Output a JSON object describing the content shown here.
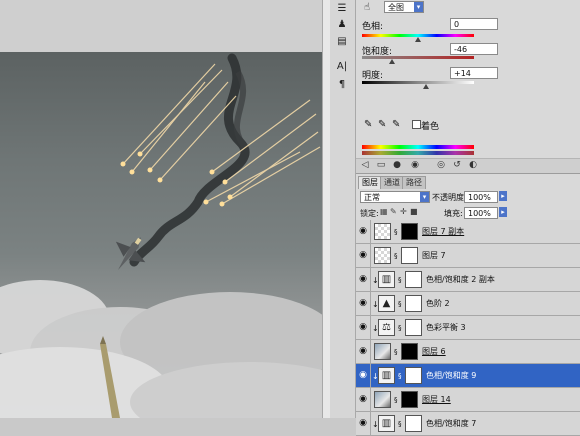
{
  "adjustments": {
    "preset_select": "全图",
    "hue": {
      "label": "色相:",
      "value": "0",
      "slider": 0.5
    },
    "saturation": {
      "label": "饱和度:",
      "value": "-46",
      "slider": 0.27
    },
    "lightness": {
      "label": "明度:",
      "value": "+14",
      "slider": 0.57
    },
    "colorize_label": "着色",
    "colorize_checked": false
  },
  "layers_panel": {
    "tabs": [
      "图层",
      "通道",
      "路径"
    ],
    "active_tab": 0,
    "blend_mode": "正常",
    "opacity_label": "不透明度:",
    "opacity_value": "100%",
    "lock_label": "锁定:",
    "fill_label": "填充:",
    "fill_value": "100%",
    "layers": [
      {
        "name": "图层 7 副本",
        "thumb": "checker",
        "mask": "black",
        "clipped": false,
        "underline": true,
        "selected": false
      },
      {
        "name": "图层 7",
        "thumb": "checker",
        "mask": "white",
        "clipped": false,
        "underline": false,
        "selected": false
      },
      {
        "name": "色相/饱和度 2 副本",
        "thumb": "adj-hue",
        "mask": "white",
        "clipped": true,
        "underline": false,
        "selected": false
      },
      {
        "name": "色阶 2",
        "thumb": "adj-levels",
        "mask": "white",
        "clipped": true,
        "underline": false,
        "selected": false
      },
      {
        "name": "色彩平衡 3",
        "thumb": "adj-balance",
        "mask": "white",
        "clipped": true,
        "underline": false,
        "selected": false
      },
      {
        "name": "图层 6",
        "thumb": "photo",
        "mask": "shape",
        "clipped": false,
        "underline": true,
        "selected": false
      },
      {
        "name": "色相/饱和度 9",
        "thumb": "adj-hue",
        "mask": "white",
        "clipped": true,
        "underline": false,
        "selected": true
      },
      {
        "name": "图层 14",
        "thumb": "photo",
        "mask": "black",
        "clipped": false,
        "underline": true,
        "selected": false
      },
      {
        "name": "色相/饱和度 7",
        "thumb": "adj-hue",
        "mask": "white",
        "clipped": true,
        "underline": false,
        "selected": false
      }
    ]
  },
  "icons": {
    "eye": "eye-icon",
    "link": "link-icon",
    "clip": "clip-arrow-icon"
  }
}
